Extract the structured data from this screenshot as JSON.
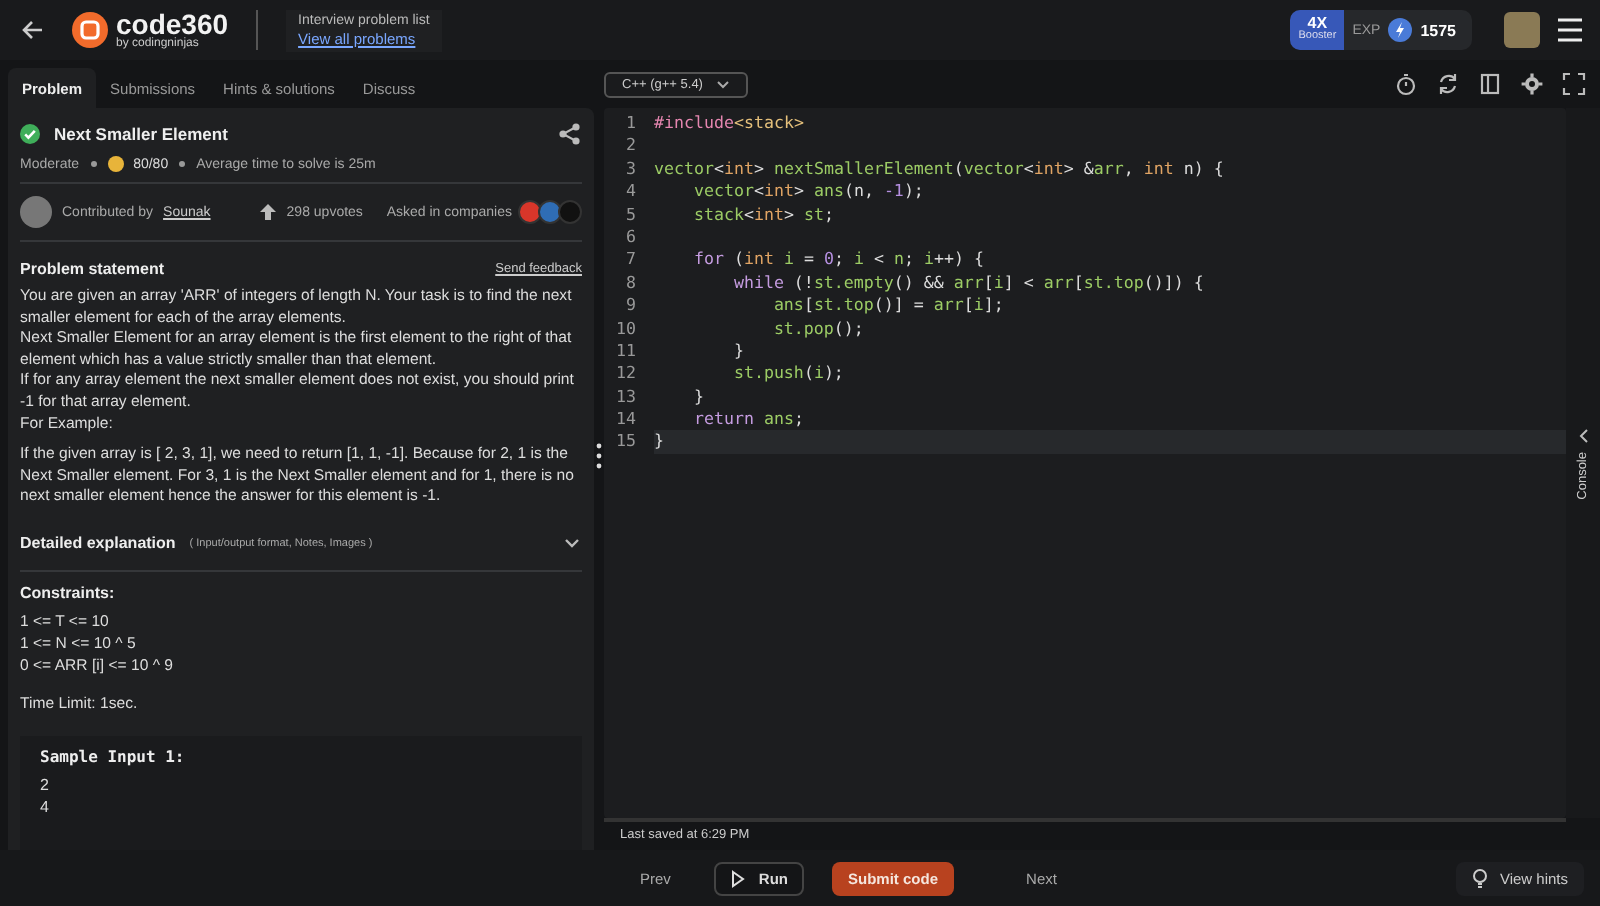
{
  "header": {
    "logo": {
      "name": "code360",
      "byline": "by codingninjas"
    },
    "breadcrumb": "Interview problem list",
    "link": "View all problems",
    "booster": {
      "multiplier": "4X",
      "label": "Booster"
    },
    "exp_label": "EXP",
    "exp_value": "1575"
  },
  "tabs": [
    {
      "label": "Problem",
      "selected": true
    },
    {
      "label": "Submissions",
      "selected": false
    },
    {
      "label": "Hints & solutions",
      "selected": false
    },
    {
      "label": "Discuss",
      "selected": false
    }
  ],
  "problem": {
    "title": "Next Smaller Element",
    "difficulty": "Moderate",
    "score": "80/80",
    "avg_time": "Average time to solve is 25m",
    "contributed_label": "Contributed by",
    "contributor": "Sounak",
    "upvotes": "298 upvotes",
    "companies_label": "Asked in companies",
    "companies": [
      {
        "color": "#d8362a"
      },
      {
        "color": "#2f6db5"
      },
      {
        "color": "#111111"
      }
    ],
    "statement_title": "Problem statement",
    "feedback": "Send feedback",
    "statement": [
      "You are given an array 'ARR' of integers of length N. Your task is to find the next smaller element for each of the array elements.",
      "Next Smaller Element for an array element is the first element to the right of that element which has a value strictly smaller than that element.",
      "If for any array element the next smaller element does not exist, you should print -1 for that array element.",
      "For Example:"
    ],
    "example": "If the given array is [ 2, 3, 1], we need to return [1, 1, -1]. Because for  2, 1 is the Next Smaller element. For 3, 1 is the Next Smaller element and for 1, there is no next smaller element hence the answer for this element is -1.",
    "details_title": "Detailed explanation",
    "details_hint": "( Input/output format, Notes, Images )",
    "details_expanded": false,
    "constraints_title": "Constraints:",
    "constraints": [
      "1 <= T <= 10",
      "1 <= N <= 10 ^ 5",
      "0 <= ARR [i] <= 10 ^ 9"
    ],
    "time_limit": "Time Limit: 1sec.",
    "sample_title": "Sample Input 1:",
    "sample_lines": [
      "2",
      "4"
    ]
  },
  "editor": {
    "language": "C++ (g++ 5.4)",
    "lines": [
      {
        "number": "1",
        "current": false,
        "tokens": [
          {
            "kind": "pre",
            "text": "#include"
          },
          {
            "kind": "str",
            "text": "<stack>"
          }
        ]
      },
      {
        "number": "2",
        "current": false
      },
      {
        "number": "3",
        "current": false,
        "tokens": [
          {
            "kind": "id",
            "text": "vector"
          },
          {
            "kind": "op",
            "text": "<"
          },
          {
            "kind": "type",
            "text": "int"
          },
          {
            "kind": "op",
            "text": "> "
          },
          {
            "kind": "id",
            "text": "nextSmallerElement"
          },
          {
            "kind": "op",
            "text": "("
          },
          {
            "kind": "id",
            "text": "vector"
          },
          {
            "kind": "op",
            "text": "<"
          },
          {
            "kind": "type",
            "text": "int"
          },
          {
            "kind": "op",
            "text": "> &"
          },
          {
            "kind": "id",
            "text": "arr"
          },
          {
            "kind": "op",
            "text": ", "
          },
          {
            "kind": "type",
            "text": "int"
          },
          {
            "kind": "op",
            "text": " n) {"
          }
        ]
      },
      {
        "number": "4",
        "current": false,
        "tokens": [
          {
            "kind": "id",
            "text": "    vector"
          },
          {
            "kind": "op",
            "text": "<"
          },
          {
            "kind": "type",
            "text": "int"
          },
          {
            "kind": "op",
            "text": "> "
          },
          {
            "kind": "id",
            "text": "ans"
          },
          {
            "kind": "op",
            "text": "(n, "
          },
          {
            "kind": "num",
            "text": "-1"
          },
          {
            "kind": "op",
            "text": ");"
          }
        ]
      },
      {
        "number": "5",
        "current": false,
        "tokens": [
          {
            "kind": "id",
            "text": "    stack"
          },
          {
            "kind": "op",
            "text": "<"
          },
          {
            "kind": "type",
            "text": "int"
          },
          {
            "kind": "op",
            "text": "> "
          },
          {
            "kind": "id",
            "text": "st"
          },
          {
            "kind": "op",
            "text": ";"
          }
        ]
      },
      {
        "number": "6",
        "current": false
      },
      {
        "number": "7",
        "current": false,
        "tokens": [
          {
            "kind": "kw",
            "text": "    for"
          },
          {
            "kind": "op",
            "text": " ("
          },
          {
            "kind": "type",
            "text": "int"
          },
          {
            "kind": "id",
            "text": " i"
          },
          {
            "kind": "op",
            "text": " = "
          },
          {
            "kind": "num",
            "text": "0"
          },
          {
            "kind": "op",
            "text": "; "
          },
          {
            "kind": "id",
            "text": "i"
          },
          {
            "kind": "op",
            "text": " < "
          },
          {
            "kind": "id",
            "text": "n"
          },
          {
            "kind": "op",
            "text": "; "
          },
          {
            "kind": "id",
            "text": "i"
          },
          {
            "kind": "op",
            "text": "++) {"
          }
        ]
      },
      {
        "number": "8",
        "current": false,
        "tokens": [
          {
            "kind": "kw",
            "text": "        while"
          },
          {
            "kind": "op",
            "text": " (!"
          },
          {
            "kind": "id",
            "text": "st.empty"
          },
          {
            "kind": "op",
            "text": "() && "
          },
          {
            "kind": "id",
            "text": "arr"
          },
          {
            "kind": "op",
            "text": "["
          },
          {
            "kind": "id",
            "text": "i"
          },
          {
            "kind": "op",
            "text": "] < "
          },
          {
            "kind": "id",
            "text": "arr"
          },
          {
            "kind": "op",
            "text": "["
          },
          {
            "kind": "id",
            "text": "st.top"
          },
          {
            "kind": "op",
            "text": "()]) {"
          }
        ]
      },
      {
        "number": "9",
        "current": false,
        "tokens": [
          {
            "kind": "id",
            "text": "            ans"
          },
          {
            "kind": "op",
            "text": "["
          },
          {
            "kind": "id",
            "text": "st.top"
          },
          {
            "kind": "op",
            "text": "()] = "
          },
          {
            "kind": "id",
            "text": "arr"
          },
          {
            "kind": "op",
            "text": "["
          },
          {
            "kind": "id",
            "text": "i"
          },
          {
            "kind": "op",
            "text": "];"
          }
        ]
      },
      {
        "number": "10",
        "current": false,
        "tokens": [
          {
            "kind": "id",
            "text": "            st.pop"
          },
          {
            "kind": "op",
            "text": "();"
          }
        ]
      },
      {
        "number": "11",
        "current": false,
        "tokens": [
          {
            "kind": "op",
            "text": "        }"
          }
        ]
      },
      {
        "number": "12",
        "current": false,
        "tokens": [
          {
            "kind": "id",
            "text": "        st.push"
          },
          {
            "kind": "op",
            "text": "("
          },
          {
            "kind": "id",
            "text": "i"
          },
          {
            "kind": "op",
            "text": ");"
          }
        ]
      },
      {
        "number": "13",
        "current": false,
        "tokens": [
          {
            "kind": "op",
            "text": "    }"
          }
        ]
      },
      {
        "number": "14",
        "current": false,
        "tokens": [
          {
            "kind": "kw",
            "text": "    return"
          },
          {
            "kind": "id",
            "text": " ans"
          },
          {
            "kind": "op",
            "text": ";"
          }
        ]
      },
      {
        "number": "15",
        "current": true,
        "tokens": [
          {
            "kind": "op",
            "text": "}"
          }
        ]
      }
    ],
    "last_saved": "Last saved at 6:29 PM",
    "console_label": "Console"
  },
  "footer": {
    "prev": "Prev",
    "run": "Run",
    "submit": "Submit code",
    "next": "Next",
    "hints": "View hints"
  }
}
